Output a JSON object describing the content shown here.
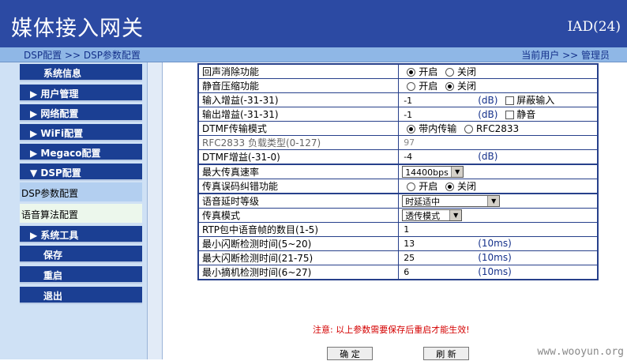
{
  "header": {
    "title": "媒体接入网关",
    "model": "IAD(24)"
  },
  "breadcrumb": {
    "path": "DSP配置 >> DSP参数配置",
    "user": "当前用户 >> 管理员"
  },
  "sidebar": {
    "items": [
      {
        "label": "系统信息"
      },
      {
        "label": "▶ 用户管理"
      },
      {
        "label": "▶ 网络配置"
      },
      {
        "label": "▶ WiFi配置"
      },
      {
        "label": "▶ Megaco配置"
      },
      {
        "label": "▼ DSP配置"
      },
      {
        "label": "DSP参数配置"
      },
      {
        "label": "语音算法配置"
      },
      {
        "label": "▶ 系统工具"
      },
      {
        "label": "保存"
      },
      {
        "label": "重启"
      },
      {
        "label": "退出"
      }
    ]
  },
  "form": {
    "echo_cancel": {
      "label": "回声消除功能",
      "on": "开启",
      "off": "关闭",
      "selected": "开启"
    },
    "silence_comp": {
      "label": "静音压缩功能",
      "on": "开启",
      "off": "关闭",
      "selected": "关闭"
    },
    "input_gain": {
      "label": "输入增益(-31-31)",
      "value": "-1",
      "unit": "(dB)",
      "check_label": "屏蔽输入"
    },
    "output_gain": {
      "label": "输出增益(-31-31)",
      "value": "-1",
      "unit": "(dB)",
      "check_label": "静音"
    },
    "dtmf_mode": {
      "label": "DTMF传输模式",
      "opt1": "带内传输",
      "opt2": "RFC2833",
      "selected": "带内传输"
    },
    "rfc2833_type": {
      "label": "RFC2833 负载类型(0-127)",
      "value": "97"
    },
    "dtmf_gain": {
      "label": "DTMF增益(-31-0)",
      "value": "-4",
      "unit": "(dB)"
    },
    "fax_rate": {
      "label": "最大传真速率",
      "value": "14400bps"
    },
    "fax_ecm": {
      "label": "传真误码纠错功能",
      "on": "开启",
      "off": "关闭",
      "selected": "关闭"
    },
    "delay_level": {
      "label": "语音延时等级",
      "value": "时延适中"
    },
    "fax_mode": {
      "label": "传真模式",
      "value": "透传模式"
    },
    "rtp_frames": {
      "label": "RTP包中语音帧的数目(1-5)",
      "value": "1"
    },
    "min_flash": {
      "label": "最小闪断检测时间(5~20)",
      "value": "13",
      "unit": "(10ms)"
    },
    "max_flash": {
      "label": "最大闪断检测时间(21-75)",
      "value": "25",
      "unit": "(10ms)"
    },
    "min_onhook": {
      "label": "最小摘机检测时间(6~27)",
      "value": "6",
      "unit": "(10ms)"
    }
  },
  "note": "注意: 以上参数需要保存后重启才能生效!",
  "buttons": {
    "ok": "确 定",
    "refresh": "刷 新"
  },
  "watermark": "www.wooyun.org",
  "colors": {
    "header": "#2c4aa3",
    "nav": "#1b3f93",
    "crumb": "#8fb7e6",
    "note": "#d40000"
  }
}
